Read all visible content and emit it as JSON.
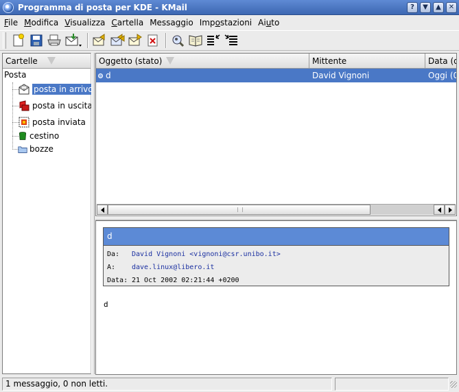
{
  "window": {
    "title": "Programma di posta per KDE - KMail"
  },
  "menubar": {
    "items": [
      {
        "pre": "",
        "u": "F",
        "post": "ile"
      },
      {
        "pre": "",
        "u": "M",
        "post": "odifica"
      },
      {
        "pre": "",
        "u": "V",
        "post": "isualizza"
      },
      {
        "pre": "",
        "u": "C",
        "post": "artella"
      },
      {
        "pre": "Messa",
        "u": "g",
        "post": "gio"
      },
      {
        "pre": "Imp",
        "u": "o",
        "post": "stazioni"
      },
      {
        "pre": "Ai",
        "u": "u",
        "post": "to"
      }
    ]
  },
  "toolbar": {
    "icons": [
      "new-message-icon",
      "save-icon",
      "print-icon",
      "check-mail-icon",
      "reply-icon",
      "reply-all-icon",
      "forward-icon",
      "delete-icon",
      "find-icon",
      "address-book-icon",
      "previous-unread-icon",
      "next-unread-icon"
    ]
  },
  "folders": {
    "header": "Cartelle",
    "root": "Posta",
    "items": [
      {
        "label": "posta in arrivo",
        "icon": "inbox-icon",
        "selected": true
      },
      {
        "label": "posta in uscita",
        "icon": "outbox-icon",
        "selected": false
      },
      {
        "label": "posta inviata",
        "icon": "sent-mail-icon",
        "selected": false
      },
      {
        "label": "cestino",
        "icon": "trash-icon",
        "selected": false
      },
      {
        "label": "bozze",
        "icon": "drafts-icon",
        "selected": false
      }
    ]
  },
  "messages": {
    "columns": [
      "Oggetto (stato)",
      "Mittente",
      "Data (d"
    ],
    "rows": [
      {
        "subject": "d",
        "sender": "David Vignoni",
        "date": "Oggi (0"
      }
    ]
  },
  "reader": {
    "subject": "d",
    "from_label": "Da:",
    "from": "David Vignoni <vignoni@csr.unibo.it>",
    "to_label": "A:",
    "to": "dave.linux@libero.it",
    "date_label": "Data:",
    "date": "21 Oct 2002 02:21:44 +0200",
    "body": "d"
  },
  "status": {
    "text": "1 messaggio, 0 non letti."
  },
  "colors": {
    "selection": "#4a78c6",
    "header_bg": "#5c8ad6",
    "link": "#1a2fa0"
  }
}
